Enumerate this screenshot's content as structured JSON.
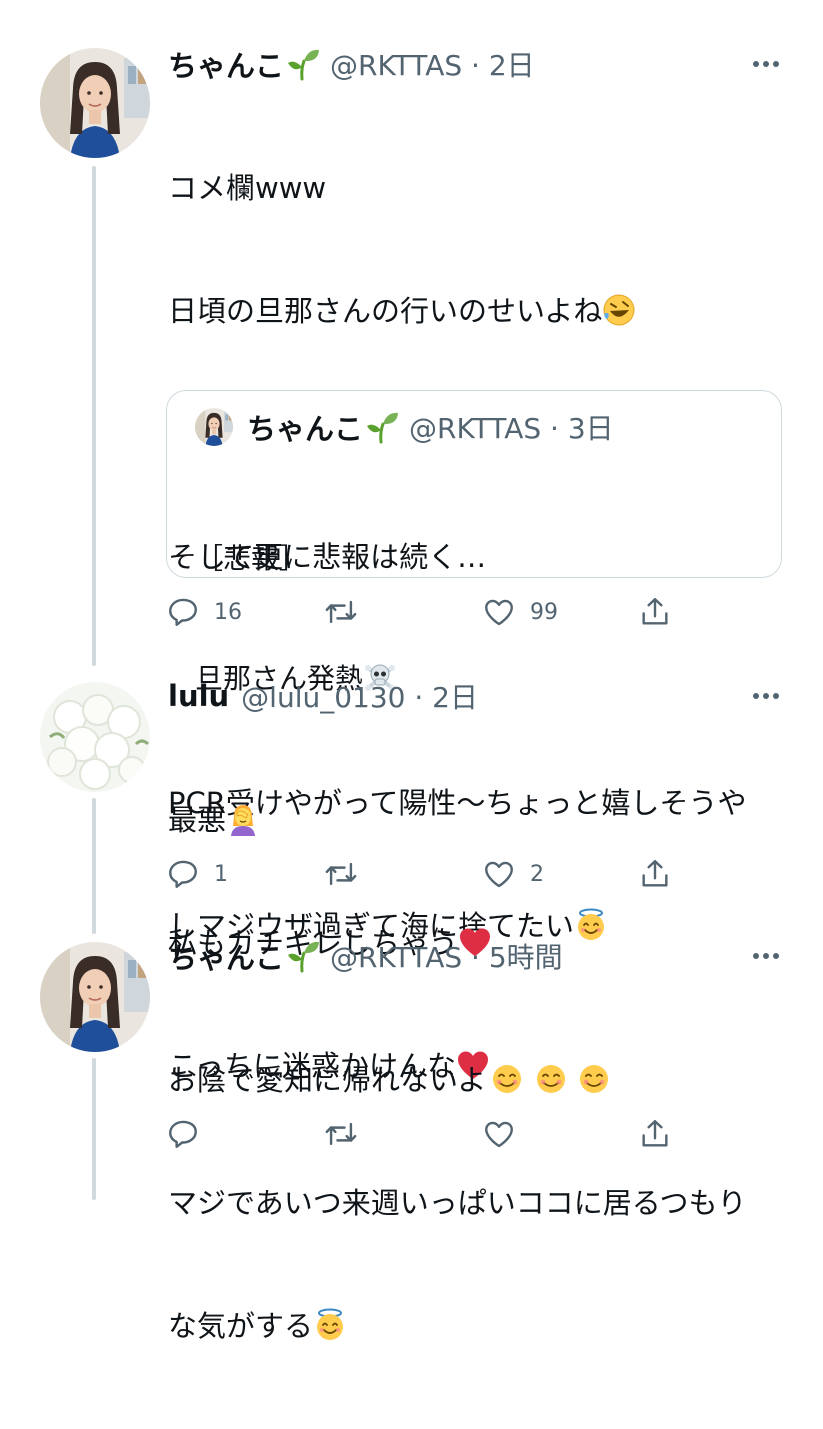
{
  "tweets": [
    {
      "name": "ちゃんこ",
      "handle": "@RKTTAS · 2日",
      "lines": [
        "コメ欄www",
        "日頃の旦那さんの行いのせいよね",
        "",
        "そして更に悲報は続く…",
        "",
        "PCR受けやがって陽性〜ちょっと嬉しそうや",
        "しマジウザ過ぎて海に捨てたい"
      ],
      "quote": {
        "name": "ちゃんこ",
        "handle": "@RKTTAS · 3日",
        "line1": "［悲報］",
        "line2": "旦那さん発熱"
      },
      "replies": "16",
      "retweets": "",
      "likes": "99"
    },
    {
      "name": "lulu",
      "handle": "@lulu_0130 · 2日",
      "line1": "最悪",
      "line2": "私もガチギレしちゃう",
      "line3": "こっちに迷惑かけんな",
      "replies": "1",
      "retweets": "",
      "likes": "2"
    },
    {
      "name": "ちゃんこ",
      "handle": "@RKTTAS · 5時間",
      "line1": "お陰で愛知に帰れないよ",
      "line2": "マジであいつ来週いっぱいココに居るつもり",
      "line3": "な気がする",
      "replies": "",
      "retweets": "",
      "likes": ""
    }
  ],
  "icons": {
    "reply": "reply-icon",
    "retweet": "retweet-icon",
    "like": "heart-icon",
    "share": "share-icon",
    "more": "more-icon"
  },
  "colors": {
    "text": "#0f1419",
    "secondary": "#536471",
    "border": "#cfd9de",
    "heart": "#e0245e",
    "sprout": "#5aa02c"
  }
}
